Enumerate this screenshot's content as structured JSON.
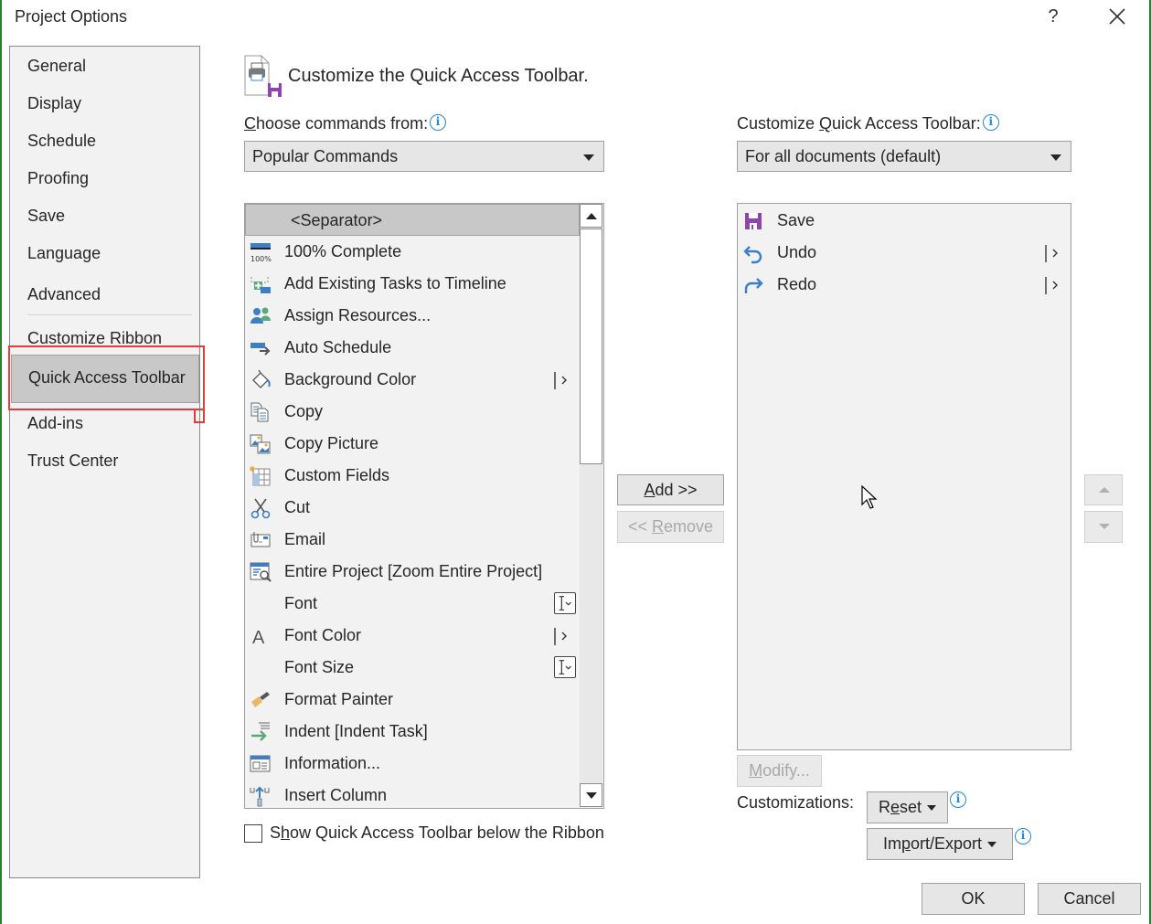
{
  "window": {
    "title": "Project Options",
    "help_label": "?",
    "close_label": "close"
  },
  "sidebar": {
    "items": [
      {
        "label": "General"
      },
      {
        "label": "Display"
      },
      {
        "label": "Schedule"
      },
      {
        "label": "Proofing"
      },
      {
        "label": "Save"
      },
      {
        "label": "Language"
      },
      {
        "label": "Advanced"
      },
      {
        "label": "Customize Ribbon"
      },
      {
        "label": "Quick Access Toolbar",
        "selected": true
      },
      {
        "label": "Add-ins"
      },
      {
        "label": "Trust Center"
      }
    ]
  },
  "header": {
    "title": "Customize the Quick Access Toolbar."
  },
  "choose_commands": {
    "label_u": "C",
    "label_rest": "hoose commands from:",
    "selected": "Popular Commands"
  },
  "commands": {
    "items": [
      {
        "label": "<Separator>",
        "icon": "none",
        "selected": true
      },
      {
        "label": "100% Complete",
        "icon": "percent-complete-icon"
      },
      {
        "label": "Add Existing Tasks to Timeline",
        "icon": "add-to-timeline-icon"
      },
      {
        "label": "Assign Resources...",
        "icon": "assign-resources-icon"
      },
      {
        "label": "Auto Schedule",
        "icon": "auto-schedule-icon"
      },
      {
        "label": "Background Color",
        "icon": "paint-bucket-icon",
        "submenu": true
      },
      {
        "label": "Copy",
        "icon": "copy-icon"
      },
      {
        "label": "Copy Picture",
        "icon": "copy-picture-icon"
      },
      {
        "label": "Custom Fields",
        "icon": "custom-fields-icon"
      },
      {
        "label": "Cut",
        "icon": "scissors-icon"
      },
      {
        "label": "Email",
        "icon": "email-icon"
      },
      {
        "label": "Entire Project [Zoom Entire Project]",
        "icon": "zoom-project-icon"
      },
      {
        "label": "Font",
        "icon": "none",
        "font_picker": true
      },
      {
        "label": "Font Color",
        "icon": "font-color-icon",
        "submenu": true
      },
      {
        "label": "Font Size",
        "icon": "none",
        "font_picker": true
      },
      {
        "label": "Format Painter",
        "icon": "format-painter-icon"
      },
      {
        "label": "Indent [Indent Task]",
        "icon": "indent-icon"
      },
      {
        "label": "Information...",
        "icon": "information-icon"
      },
      {
        "label": "Insert Column",
        "icon": "insert-column-icon"
      }
    ],
    "scroll_position_fraction": 0.0
  },
  "customize_qat": {
    "label_pre": "Customize ",
    "label_u": "Q",
    "label_rest": "uick Access Toolbar:",
    "selected": "For all documents (default)",
    "items": [
      {
        "label": "Save",
        "icon": "save-icon"
      },
      {
        "label": "Undo",
        "icon": "undo-icon",
        "submenu": true
      },
      {
        "label": "Redo",
        "icon": "redo-icon",
        "submenu": true
      }
    ]
  },
  "buttons": {
    "add_u": "A",
    "add_rest": "dd >>",
    "remove_pre": "<< ",
    "remove_u": "R",
    "remove_rest": "emove",
    "modify_u": "M",
    "modify_rest": "odify...",
    "reset_pre": "R",
    "reset_u": "e",
    "reset_rest": "set",
    "import_pre": "Im",
    "import_u": "p",
    "import_rest": "ort/Export",
    "ok": "OK",
    "cancel": "Cancel"
  },
  "customizations_label": "Customizations:",
  "show_below_ribbon": {
    "label_pre": "S",
    "label_u": "h",
    "label_rest": "ow Quick Access Toolbar below the Ribbon",
    "checked": false
  },
  "info_glyph": "i"
}
